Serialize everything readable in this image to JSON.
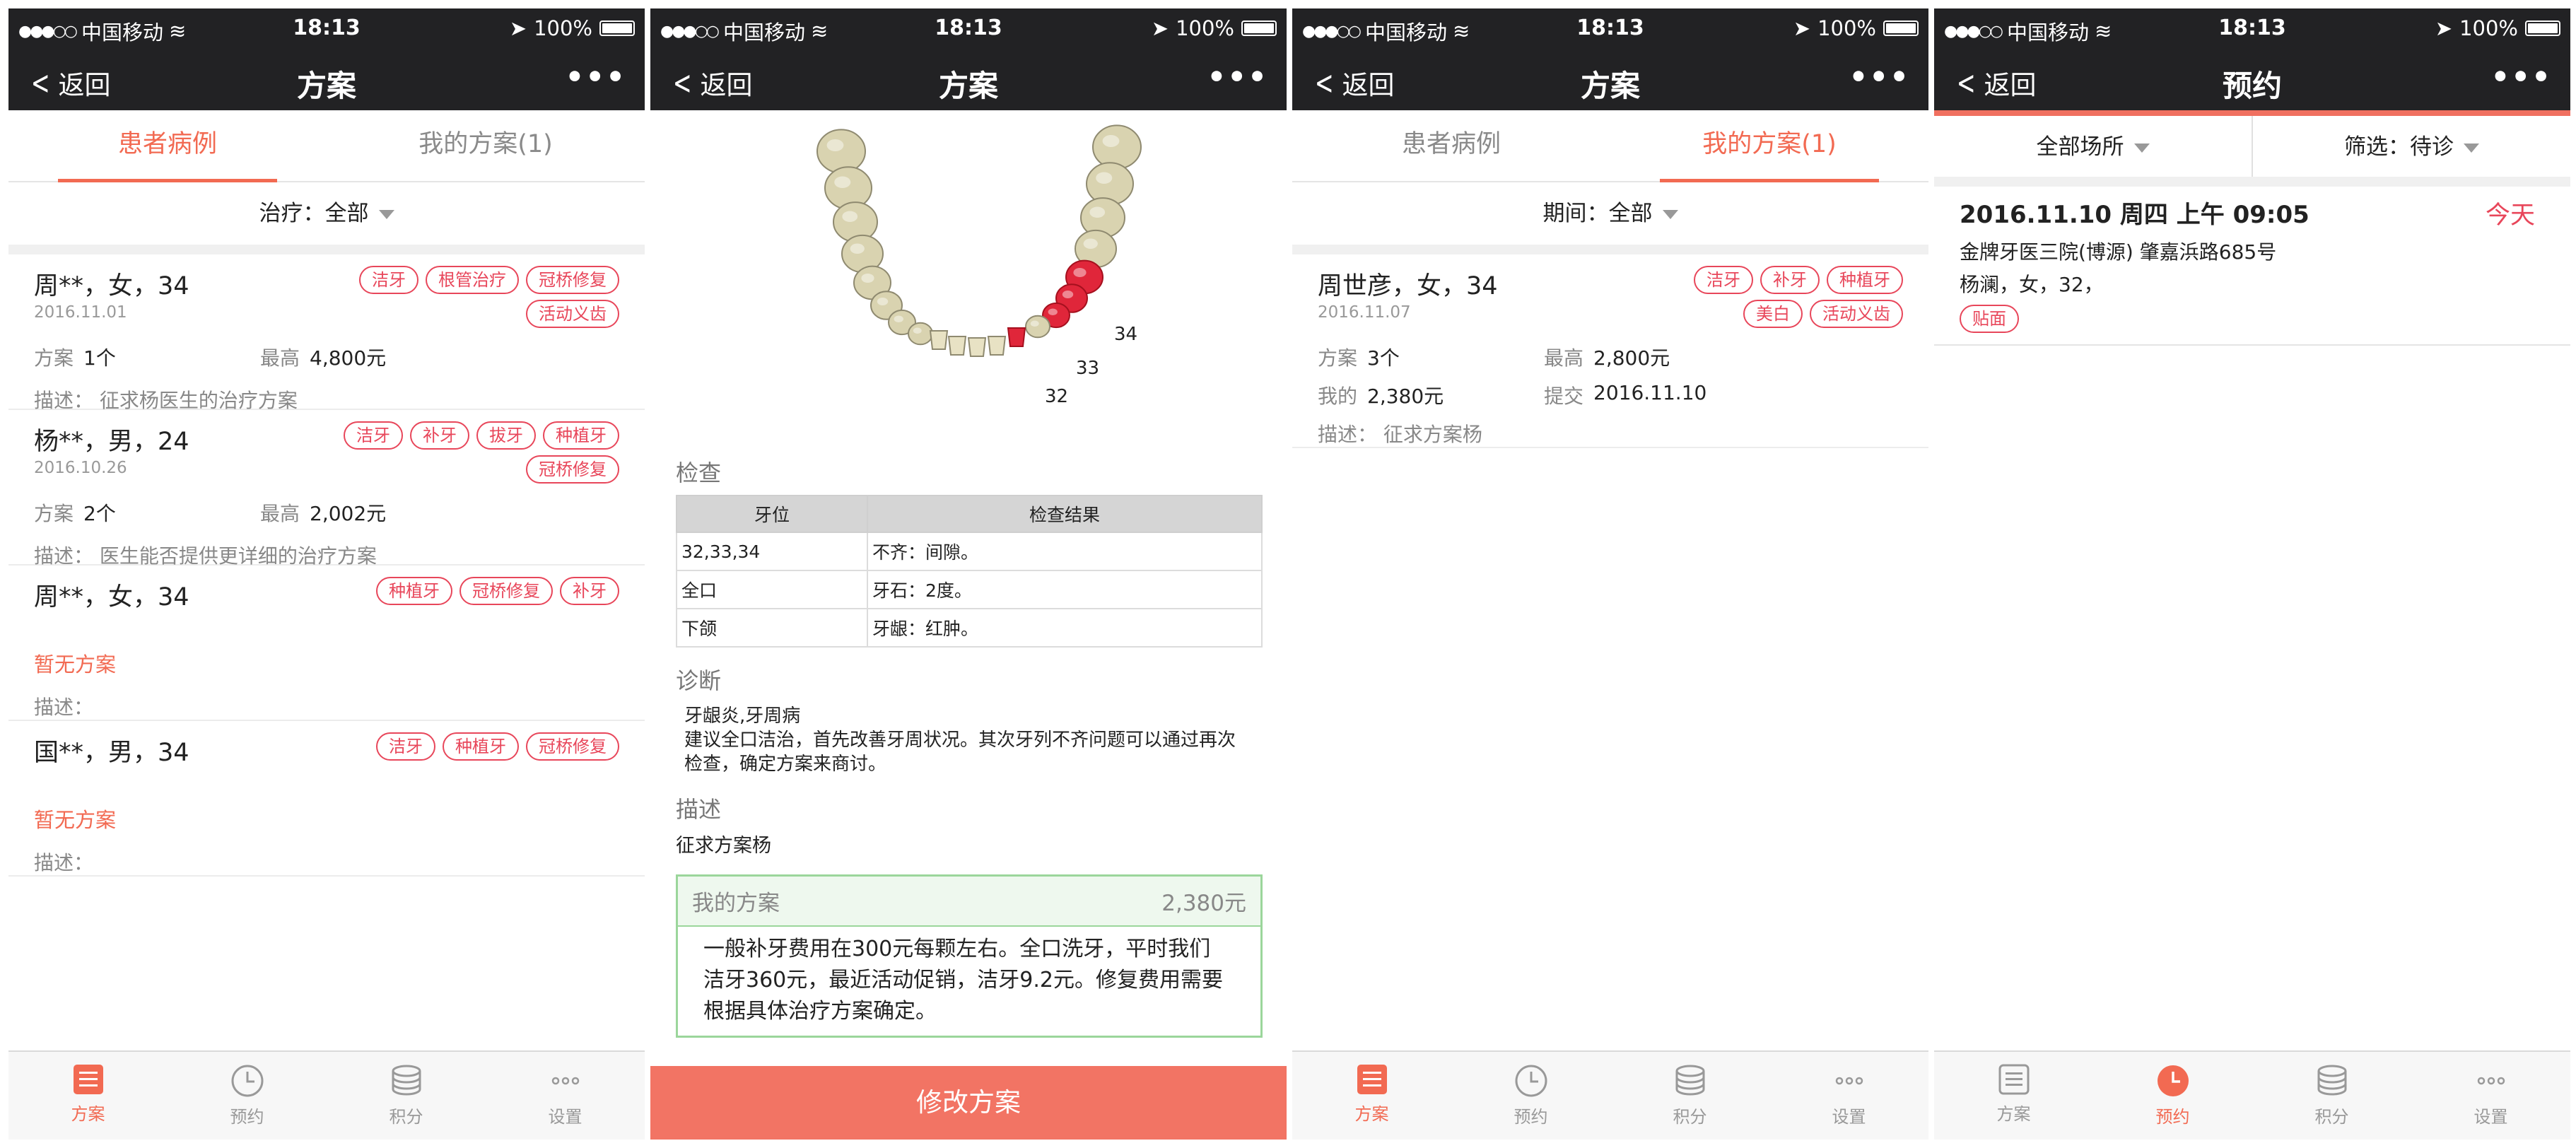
{
  "status": {
    "carrier": "中国移动",
    "time": "18:13",
    "battery": "100%"
  },
  "common": {
    "back": "返回",
    "more": "•••"
  },
  "bottom_tabs": [
    "方案",
    "预约",
    "积分",
    "设置"
  ],
  "screen1": {
    "title": "方案",
    "tabs": [
      "患者病例",
      "我的方案(1)"
    ],
    "filter": "治疗：全部",
    "cards": [
      {
        "name": "周**，女，34",
        "date": "2016.11.01",
        "tags": [
          "洁牙",
          "根管治疗",
          "冠桥修复",
          "活动义齿"
        ],
        "plan_k": "方案",
        "plan_v": "1个",
        "max_k": "最高",
        "max_v": "4,800元",
        "desc": "描述：  征求杨医生的治疗方案"
      },
      {
        "name": "杨**，男，24",
        "date": "2016.10.26",
        "tags": [
          "洁牙",
          "补牙",
          "拔牙",
          "种植牙",
          "冠桥修复"
        ],
        "plan_k": "方案",
        "plan_v": "2个",
        "max_k": "最高",
        "max_v": "2,002元",
        "desc": "描述：  医生能否提供更详细的治疗方案"
      },
      {
        "name": "周**，女，34",
        "tags": [
          "种植牙",
          "冠桥修复",
          "补牙"
        ],
        "none": "暂无方案",
        "desc": "描述："
      },
      {
        "name": "国**，男，34",
        "tags": [
          "洁牙",
          "种植牙",
          "冠桥修复"
        ],
        "none": "暂无方案",
        "desc": "描述："
      }
    ]
  },
  "screen2": {
    "title": "方案",
    "tooth_labels": [
      "34",
      "33",
      "32"
    ],
    "exam_title": "检查",
    "exam_headers": [
      "牙位",
      "检查结果"
    ],
    "exam_rows": [
      [
        "32,33,34",
        "不齐：间隙。"
      ],
      [
        "全口",
        "牙石：2度。"
      ],
      [
        "下颌",
        "牙龈：红肿。"
      ]
    ],
    "diag_title": "诊断",
    "diag_lines": [
      "牙龈炎,牙周病",
      "建议全口洁治，首先改善牙周状况。其次牙列不齐问题可以通过再次",
      "检查，确定方案来商讨。"
    ],
    "desc_title": "描述",
    "desc_value": "征求方案杨",
    "myplan_label": "我的方案",
    "myplan_price": "2,380元",
    "myplan_body": [
      "一般补牙费用在300元每颗左右。全口洗牙，平时我们",
      "洁牙360元，最近活动促销，洁牙9.2元。修复费用需要",
      "根据具体治疗方案确定。"
    ],
    "button": "修改方案"
  },
  "screen3": {
    "title": "方案",
    "tabs": [
      "患者病例",
      "我的方案(1)"
    ],
    "filter": "期间：全部",
    "card": {
      "name": "周世彦，女，34",
      "date": "2016.11.07",
      "tags": [
        "洁牙",
        "补牙",
        "种植牙",
        "美白",
        "活动义齿"
      ],
      "plan_k": "方案",
      "plan_v": "3个",
      "max_k": "最高",
      "max_v": "2,800元",
      "mine_k": "我的",
      "mine_v": "2,380元",
      "submit_k": "提交",
      "submit_v": "2016.11.10",
      "desc": "描述：  征求方案杨"
    }
  },
  "screen4": {
    "title": "预约",
    "filter_left": "全部场所",
    "filter_right": "筛选：待诊",
    "appt": {
      "when": "2016.11.10 周四 上午 09:05",
      "today": "今天",
      "place": "金牌牙医三院(博源) 肇嘉浜路685号",
      "patient": "杨澜，女，32，",
      "tag": "贴面"
    }
  },
  "colors": {
    "accent": "#f26a52",
    "tag": "#e8465a",
    "navbar": "#222224",
    "plan_border": "#9bd69b"
  }
}
